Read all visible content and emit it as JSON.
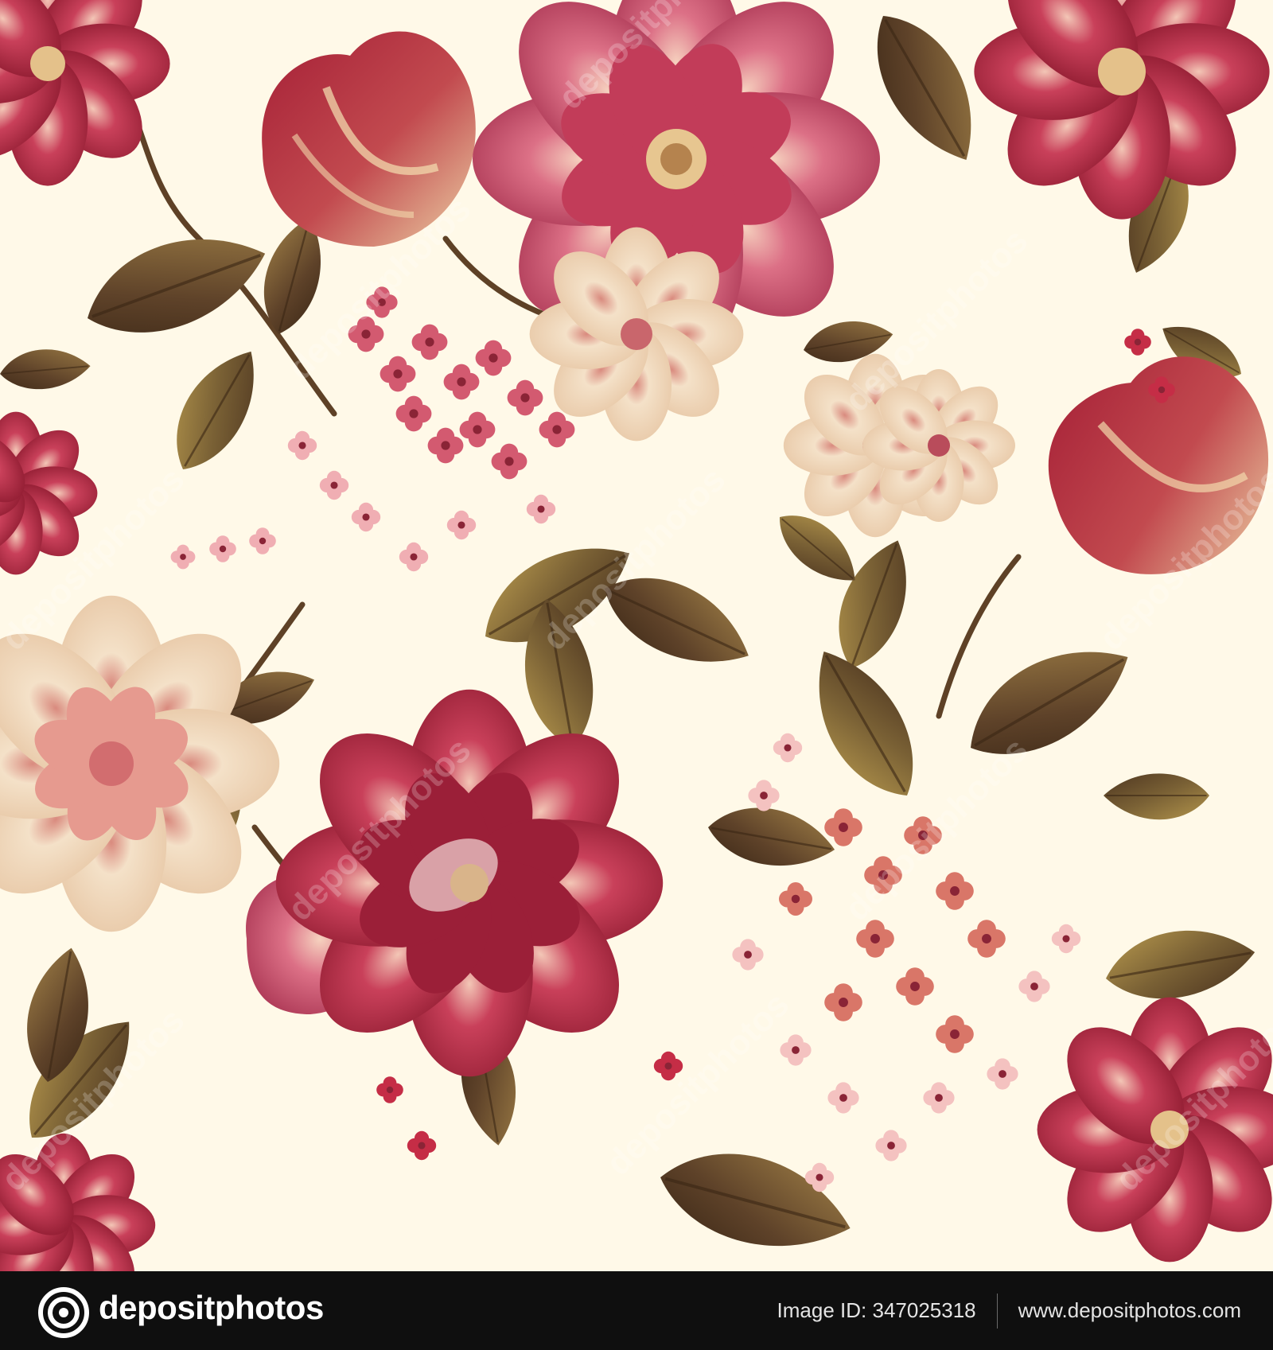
{
  "artwork": {
    "subject": "seamless floral pattern",
    "colors": {
      "background": "#fff9e8",
      "crimson": "#b2273f",
      "rose": "#d96a7f",
      "blush": "#f2b8b6",
      "cream_petal": "#f1dcc0",
      "leaf_olive": "#7f6a3a",
      "leaf_brown": "#5a3f25",
      "leaf_gold": "#a88a43"
    },
    "watermark_text": "depositphotos"
  },
  "footer": {
    "brand": "depositphotos",
    "image_id": "Image ID: 347025318",
    "website": "www.depositphotos.com",
    "background_color": "#0f0f0f"
  }
}
